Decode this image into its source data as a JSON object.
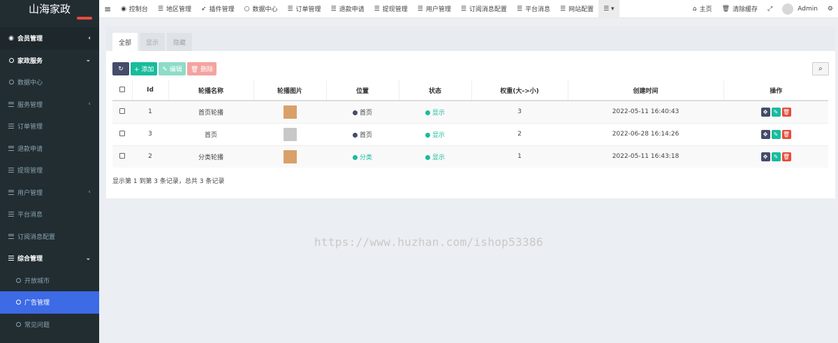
{
  "sidebar": {
    "brand": "山海家政",
    "items": [
      {
        "label": "会员管理",
        "icon": "user-circle-icon",
        "arrow": "‹"
      },
      {
        "label": "家政服务",
        "icon": "circle-icon",
        "arrow": "⌄"
      },
      {
        "label": "数据中心",
        "icon": "circle-icon"
      },
      {
        "label": "服务管理",
        "icon": "list-icon",
        "arrow": "‹"
      },
      {
        "label": "订单管理",
        "icon": "list-icon"
      },
      {
        "label": "退款申请",
        "icon": "list-icon"
      },
      {
        "label": "提现管理",
        "icon": "list-icon"
      },
      {
        "label": "用户管理",
        "icon": "list-icon",
        "arrow": "‹"
      },
      {
        "label": "平台消息",
        "icon": "list-icon"
      },
      {
        "label": "订阅消息配置",
        "icon": "list-icon"
      },
      {
        "label": "综合管理",
        "icon": "list-icon",
        "arrow": "⌄"
      },
      {
        "label": "开放城市",
        "icon": "circle-icon"
      },
      {
        "label": "广告管理",
        "icon": "circle-icon"
      },
      {
        "label": "常见问题",
        "icon": "circle-icon"
      }
    ]
  },
  "topbar": {
    "menu_icon": "≡",
    "items": [
      {
        "label": "控制台",
        "icon": "dashboard-icon",
        "glyph": "◉"
      },
      {
        "label": "地区管理",
        "icon": "list-icon",
        "glyph": "☰"
      },
      {
        "label": "插件管理",
        "icon": "rocket-icon",
        "glyph": "➶"
      },
      {
        "label": "数据中心",
        "icon": "circle-icon",
        "glyph": "○"
      },
      {
        "label": "订单管理",
        "icon": "list-icon",
        "glyph": "☰"
      },
      {
        "label": "退款申请",
        "icon": "list-icon",
        "glyph": "☰"
      },
      {
        "label": "提现管理",
        "icon": "list-icon",
        "glyph": "☰"
      },
      {
        "label": "用户管理",
        "icon": "list-icon",
        "glyph": "☰"
      },
      {
        "label": "订阅消息配置",
        "icon": "list-icon",
        "glyph": "☰"
      },
      {
        "label": "平台消息",
        "icon": "list-icon",
        "glyph": "☰"
      },
      {
        "label": "网站配置",
        "icon": "list-icon",
        "glyph": "☰"
      }
    ],
    "more_glyph": "☰ ▾",
    "home_label": "主页",
    "clear_label": "清除缓存",
    "fullscreen_glyph": "⤢",
    "user_label": "Admin",
    "settings_glyph": "⚙"
  },
  "tabs": [
    "全部",
    "显示",
    "隐藏"
  ],
  "toolbar": {
    "refresh_glyph": "↻",
    "add_label": "+ 添加",
    "edit_label": "✎ 编辑",
    "delete_label": "🗑 删除",
    "search_glyph": "⌕"
  },
  "table": {
    "headers": [
      "",
      "Id",
      "轮播名称",
      "轮播图片",
      "位置",
      "状态",
      "权重(大->小)",
      "创建时间",
      "操作"
    ],
    "rows": [
      {
        "id": "1",
        "name": "首页轮播",
        "thumb_color": "#d9a06a",
        "position": "首页",
        "position_color": "#444c69",
        "status": "显示",
        "weight": "3",
        "created": "2022-05-11 16:40:43"
      },
      {
        "id": "3",
        "name": "首页",
        "thumb_color": "#c8c8c8",
        "position": "首页",
        "position_color": "#444c69",
        "status": "显示",
        "weight": "2",
        "created": "2022-06-28 16:14:26"
      },
      {
        "id": "2",
        "name": "分类轮播",
        "thumb_color": "#d9a06a",
        "position": "分类",
        "position_color": "#18bc9c",
        "status": "显示",
        "weight": "1",
        "created": "2022-05-11 16:43:18"
      }
    ],
    "status_color": "#18bc9c"
  },
  "summary": "显示第 1 到第 3 条记录，总共 3 条记录",
  "watermark": "https://www.huzhan.com/ishop53386"
}
